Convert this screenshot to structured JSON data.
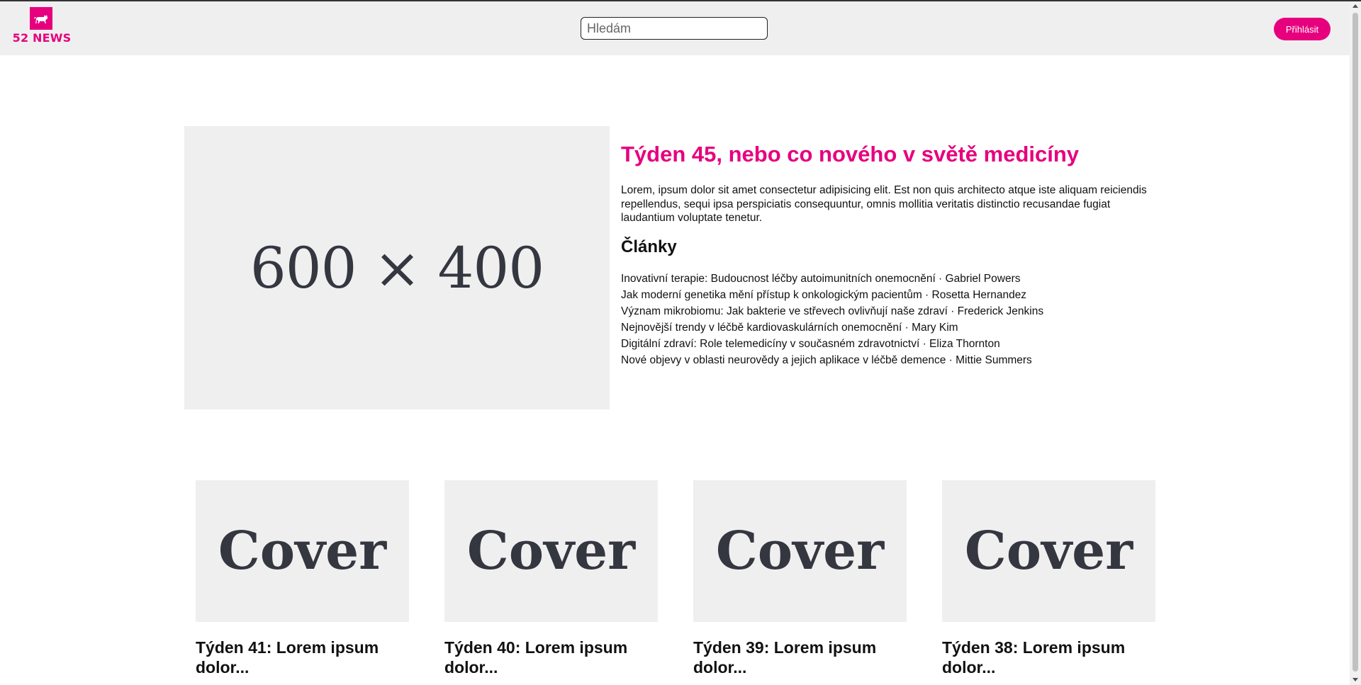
{
  "header": {
    "logo_text": "52 NEWS",
    "search_placeholder": "Hledám",
    "login_label": "Přihlásit"
  },
  "colors": {
    "accent": "#e6007e",
    "header_bg": "#efefef",
    "placeholder_bg": "#efefef"
  },
  "hero": {
    "image_label": "600 × 400",
    "title": "Týden 45, nebo co nového v světě medicíny",
    "description": "Lorem, ipsum dolor sit amet consectetur adipisicing elit. Est non quis architecto atque iste aliquam reiciendis repellendus, sequi ipsa perspiciatis consequuntur, omnis mollitia veritatis distinctio recusandae fugiat laudantium voluptate tenetur.",
    "articles_heading": "Články",
    "articles": [
      "Inovativní terapie: Budoucnost léčby autoimunitních onemocnění · Gabriel Powers",
      "Jak moderní genetika mění přístup k onkologickým pacientům · Rosetta Hernandez",
      "Význam mikrobiomu: Jak bakterie ve střevech ovlivňují naše zdraví · Frederick Jenkins",
      "Nejnovější trendy v léčbě kardiovaskulárních onemocnění · Mary Kim",
      "Digitální zdraví: Role telemedicíny v současném zdravotnictví · Eliza Thornton",
      "Nové objevy v oblasti neurovědy a jejich aplikace v léčbě demence · Mittie Summers"
    ]
  },
  "cards": [
    {
      "cover_label": "Cover",
      "title": "Týden 41: Lorem ipsum dolor..."
    },
    {
      "cover_label": "Cover",
      "title": "Týden 40: Lorem ipsum dolor..."
    },
    {
      "cover_label": "Cover",
      "title": "Týden 39: Lorem ipsum dolor..."
    },
    {
      "cover_label": "Cover",
      "title": "Týden 38: Lorem ipsum dolor..."
    }
  ]
}
